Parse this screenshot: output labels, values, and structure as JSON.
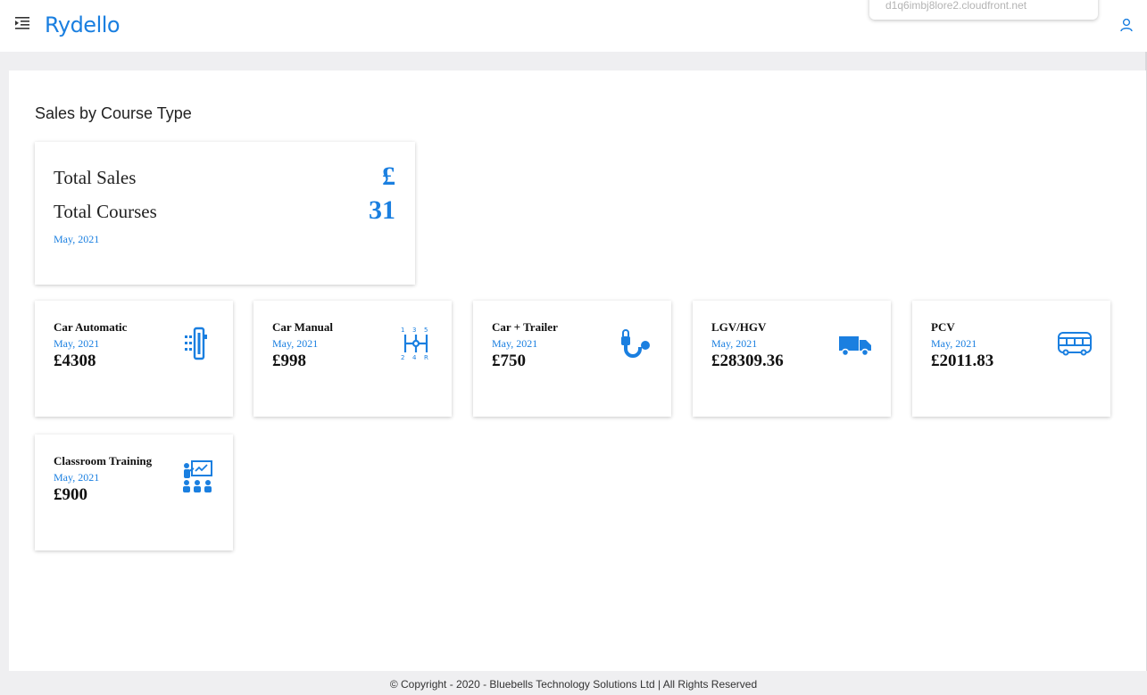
{
  "app": {
    "logo": "Rydello"
  },
  "header": {
    "url_hint": "d1q6imbj8lore2.cloudfront.net"
  },
  "page": {
    "title": "Sales by Course Type"
  },
  "summary": {
    "sales_label": "Total Sales",
    "sales_value": "£",
    "courses_label": "Total Courses",
    "courses_value": "31",
    "period": "May, 2021"
  },
  "courses": [
    {
      "name": "Car Automatic",
      "period": "May, 2021",
      "value": "£4308",
      "icon": "gear-stick-icon"
    },
    {
      "name": "Car Manual",
      "period": "May, 2021",
      "value": "£998",
      "icon": "manual-gearbox-icon"
    },
    {
      "name": "Car + Trailer",
      "period": "May, 2021",
      "value": "£750",
      "icon": "tow-hitch-icon"
    },
    {
      "name": "LGV/HGV",
      "period": "May, 2021",
      "value": "£28309.36",
      "icon": "truck-icon"
    },
    {
      "name": "PCV",
      "period": "May, 2021",
      "value": "£2011.83",
      "icon": "bus-icon"
    },
    {
      "name": "Classroom Training",
      "period": "May, 2021",
      "value": "£900",
      "icon": "classroom-icon"
    }
  ],
  "footer": {
    "copyright": "© Copyright - 2020 - Bluebells Technology Solutions Ltd | All Rights Reserved"
  },
  "colors": {
    "accent": "#1a7fe0",
    "background": "#efeff1"
  }
}
